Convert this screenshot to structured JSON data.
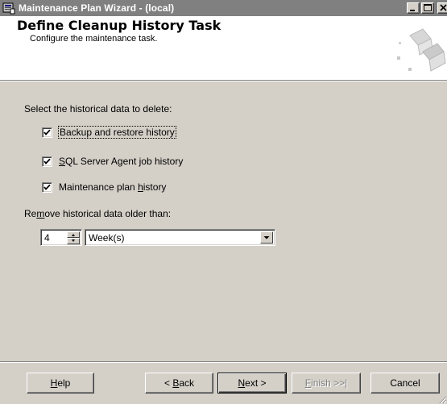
{
  "window": {
    "title": "Maintenance Plan Wizard - (local)"
  },
  "header": {
    "title": "Define Cleanup History Task",
    "subtitle": "Configure the maintenance task."
  },
  "content": {
    "select_label": "Select the historical data to delete:",
    "checkboxes": [
      {
        "label_pre": "",
        "label_mnemonic": "",
        "label_post": "Backup and restore history",
        "checked": true
      },
      {
        "label_pre": "",
        "label_mnemonic": "S",
        "label_post": "QL Server Agent job history",
        "checked": true
      },
      {
        "label_pre": "Maintenance plan ",
        "label_mnemonic": "h",
        "label_post": "istory",
        "checked": true
      }
    ],
    "remove_label_pre": "Re",
    "remove_label_mnemonic": "m",
    "remove_label_post": "ove historical data older than:",
    "age_value": "4",
    "unit_value": "Week(s)"
  },
  "footer": {
    "help": {
      "pre": "",
      "mnemonic": "H",
      "post": "elp"
    },
    "back": {
      "pre": "< ",
      "mnemonic": "B",
      "post": "ack"
    },
    "next": {
      "pre": "",
      "mnemonic": "N",
      "post": "ext >"
    },
    "finish": {
      "pre": "",
      "mnemonic": "F",
      "post": "inish >>|"
    },
    "cancel": {
      "pre": "Cancel",
      "mnemonic": "",
      "post": ""
    }
  }
}
